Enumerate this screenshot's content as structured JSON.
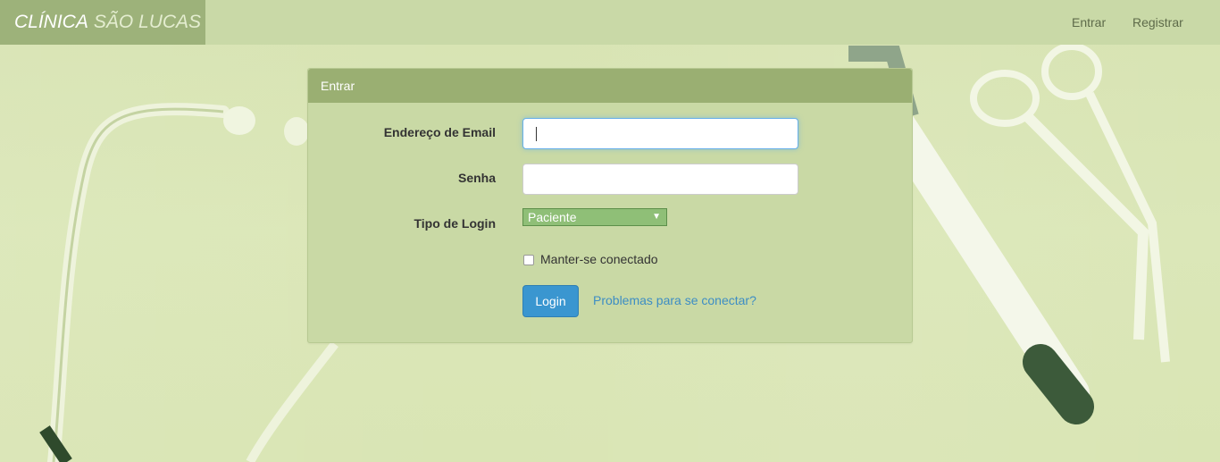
{
  "brand": {
    "part1": "CLÍNICA",
    "part2": "SÃO LUCAS"
  },
  "nav": {
    "login": "Entrar",
    "register": "Registrar"
  },
  "panel": {
    "heading": "Entrar",
    "email_label": "Endereço de Email",
    "email_value": "",
    "password_label": "Senha",
    "password_value": "",
    "login_type_label": "Tipo de Login",
    "login_type_selected": "Paciente",
    "remember_label": "Manter-se conectado",
    "remember_checked": false,
    "submit_label": "Login",
    "trouble_link": "Problemas para se conectar?"
  },
  "colors": {
    "navbar": "#c9d9a7",
    "brand_bg": "#9db27a",
    "panel_heading": "#9aaf72",
    "panel_body": "#c9d9a5",
    "button": "#3a96d0",
    "link": "#3d8dc4",
    "select_bg": "#8fbf77"
  },
  "icons": {
    "select_arrow": "caret-down-icon"
  }
}
